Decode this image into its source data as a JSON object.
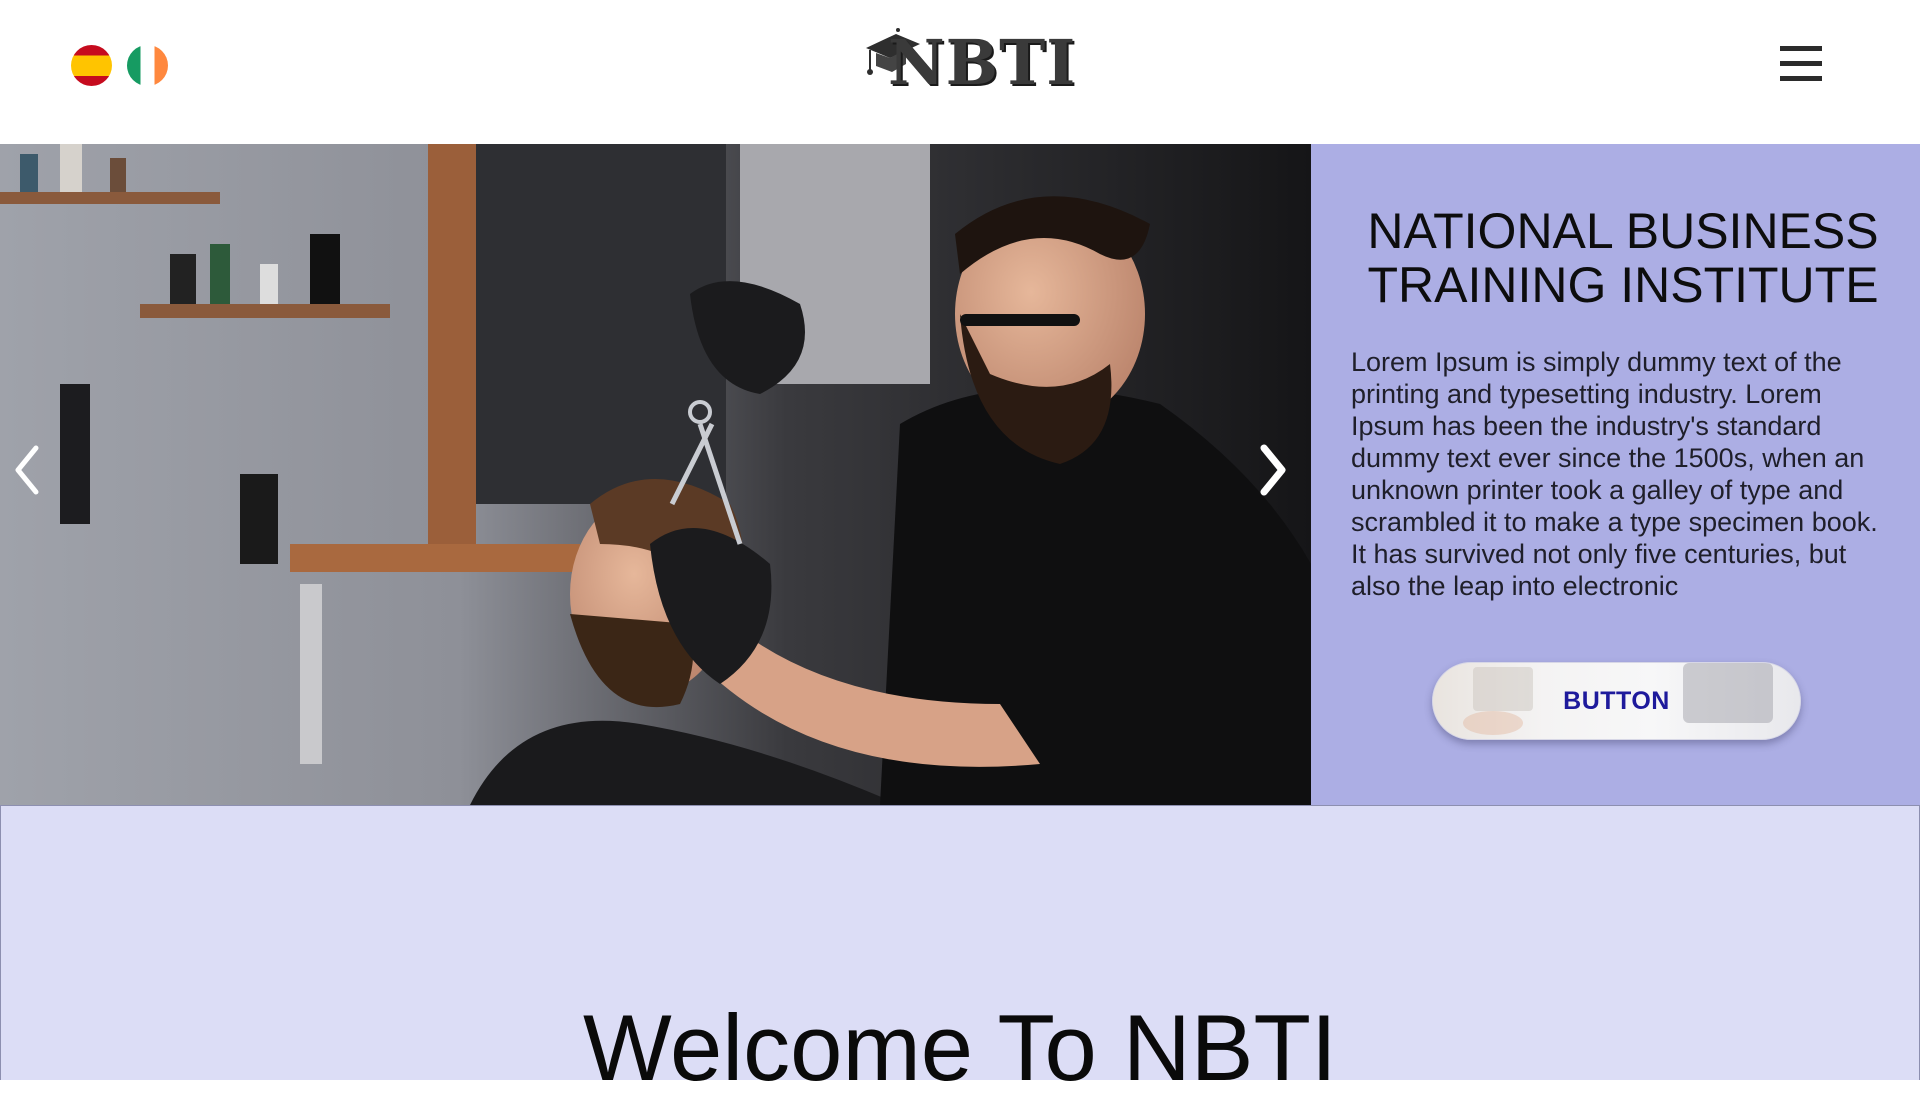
{
  "header": {
    "logo_text": "NBTI",
    "language_flags": [
      {
        "icon": "spain-flag-icon"
      },
      {
        "icon": "ireland-flag-icon"
      }
    ],
    "menu_icon": "hamburger-menu-icon"
  },
  "hero": {
    "image": "barber-cutting-hair-photo",
    "prev_icon": "chevron-left-icon",
    "next_icon": "chevron-right-icon",
    "title": "NATIONAL BUSINESS TRAINING INSTITUTE",
    "description": "Lorem Ipsum is simply dummy text of the printing and typesetting industry. Lorem Ipsum has been the industry's standard dummy text ever since the 1500s, when an unknown printer took a galley of type and scrambled it to make a type specimen book. It has survived not only five centuries, but also the leap into electronic",
    "button_label": "BUTTON"
  },
  "welcome": {
    "title": "Welcome To NBTI"
  },
  "colors": {
    "panel_background": "#acaee4",
    "welcome_background": "#dcddf6",
    "button_text": "#1e1a9c"
  }
}
